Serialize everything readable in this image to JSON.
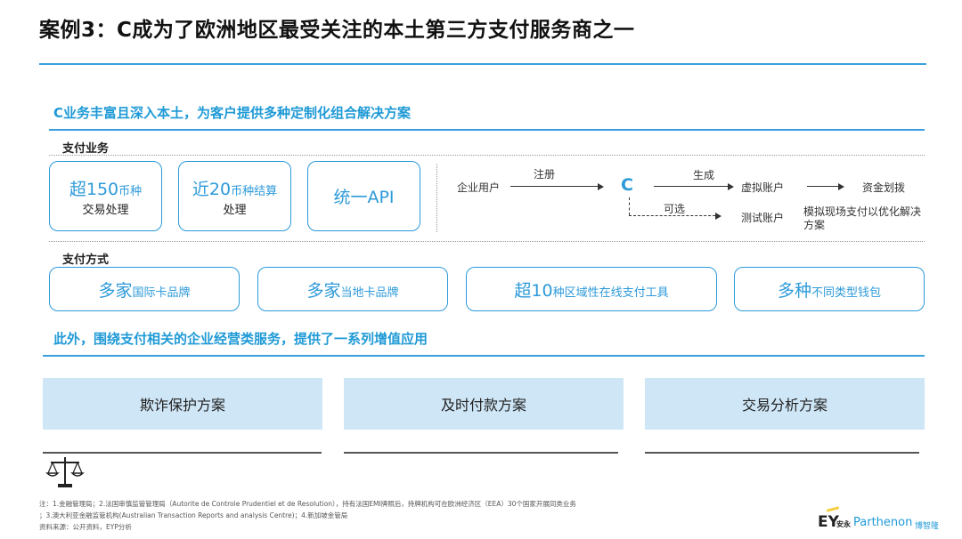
{
  "title": "案例3：C成为了欧洲地区最受关注的本土第三方支付服务商之一",
  "section1": {
    "heading": "C业务丰富且深入本土，为客户提供多种定制化组合解决方案",
    "business_label": "支付业务",
    "business_boxes": [
      {
        "prefix": "超",
        "number": "150",
        "suffix": "币种",
        "line2": "交易处理"
      },
      {
        "prefix": "近",
        "number": "20",
        "suffix": "币种结算",
        "line2": "处理"
      },
      {
        "text": "统一API"
      }
    ],
    "flow": {
      "enterprise_user": "企业用户",
      "register": "注册",
      "c_label": "C",
      "generate": "生成",
      "virtual_account": "虚拟账户",
      "fund_transfer": "资金划拨",
      "optional": "可选",
      "test_account": "测试账户",
      "simulate": "模拟现场支付以优化解决方案"
    },
    "method_label": "支付方式",
    "method_boxes": [
      {
        "big": "多家",
        "small": "国际卡品牌"
      },
      {
        "big": "多家",
        "small": "当地卡品牌"
      },
      {
        "big": "超10",
        "small": "种区域性在线支付工具"
      },
      {
        "big": "多种",
        "small": "不同类型钱包"
      }
    ]
  },
  "section2": {
    "heading": "此外，围绕支付相关的企业经营类服务，提供了一系列增值应用",
    "solutions": [
      "欺诈保护方案",
      "及时付款方案",
      "交易分析方案"
    ]
  },
  "notes": {
    "line1": "注：1.金融管理局；2.法国审慎监管管理局（Autorite de Controle Prudentiel et de Resolution），持有法国EMI牌照后，持牌机构可在欧洲经济区（EEA）30个国家开展同类业务",
    "line2": "；3.澳大利亚金融监管机构(Australian Transaction Reports and analysis Centre)；4.新加坡金管局",
    "line3": "资料来源：公开资料，EYP分析"
  },
  "logo": {
    "ey": "EY",
    "ey_cn": "安永",
    "parthenon": "Parthenon",
    "parthenon_cn": "博智隆"
  },
  "colors": {
    "accent": "#2d9ad9",
    "solution_fill": "#cfe6f6"
  }
}
